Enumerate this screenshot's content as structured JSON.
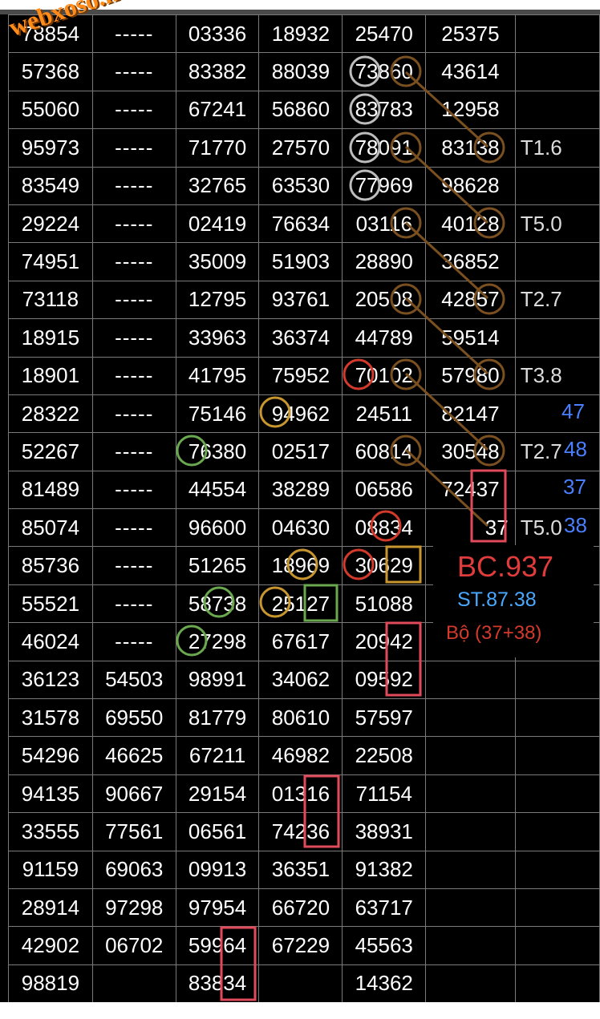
{
  "watermark": "webxoso.net",
  "rows": [
    [
      "78854",
      "-----",
      "03336",
      "18932",
      "25470",
      "25375",
      ""
    ],
    [
      "57368",
      "-----",
      "83382",
      "88039",
      "73860",
      "43614",
      ""
    ],
    [
      "55060",
      "-----",
      "67241",
      "56860",
      "83783",
      "12958",
      ""
    ],
    [
      "95973",
      "-----",
      "71770",
      "27570",
      "78091",
      "83138",
      "T1.6"
    ],
    [
      "83549",
      "-----",
      "32765",
      "63530",
      "77969",
      "98628",
      ""
    ],
    [
      "29224",
      "-----",
      "02419",
      "76634",
      "03116",
      "40128",
      "T5.0"
    ],
    [
      "74951",
      "-----",
      "35009",
      "51903",
      "28890",
      "36852",
      ""
    ],
    [
      "73118",
      "-----",
      "12795",
      "93761",
      "20508",
      "42857",
      "T2.7"
    ],
    [
      "18915",
      "-----",
      "33963",
      "36374",
      "44789",
      "59514",
      ""
    ],
    [
      "18901",
      "-----",
      "41795",
      "75952",
      "70102",
      "57980",
      "T3.8"
    ],
    [
      "28322",
      "-----",
      "75146",
      "94962",
      "24511",
      "82147",
      ""
    ],
    [
      "52267",
      "-----",
      "76380",
      "02517",
      "60814",
      "30548",
      "T2.7"
    ],
    [
      "81489",
      "-----",
      "44554",
      "38289",
      "06586",
      "72437",
      ""
    ],
    [
      "85074",
      "-----",
      "96600",
      "04630",
      "08834",
      "37",
      "T5.0"
    ],
    [
      "85736",
      "-----",
      "51265",
      "18969",
      "30629",
      "",
      ""
    ],
    [
      "55521",
      "-----",
      "58738",
      "25127",
      "51088",
      "",
      ""
    ],
    [
      "46024",
      "-----",
      "27298",
      "67617",
      "20942",
      "",
      ""
    ],
    [
      "36123",
      "54503",
      "98991",
      "34062",
      "09592",
      "",
      ""
    ],
    [
      "31578",
      "69550",
      "81779",
      "80610",
      "57597",
      "",
      ""
    ],
    [
      "54296",
      "46625",
      "67211",
      "46982",
      "22508",
      "",
      ""
    ],
    [
      "94135",
      "90667",
      "29154",
      "01316",
      "71154",
      "",
      ""
    ],
    [
      "33555",
      "77561",
      "06561",
      "74236",
      "38931",
      "",
      ""
    ],
    [
      "91159",
      "69063",
      "09913",
      "36351",
      "91382",
      "",
      ""
    ],
    [
      "28914",
      "97298",
      "97954",
      "66720",
      "63717",
      "",
      ""
    ],
    [
      "42902",
      "06702",
      "59964",
      "67229",
      "45563",
      "",
      ""
    ],
    [
      "98819",
      "",
      "83834",
      "",
      "14362",
      "",
      ""
    ]
  ],
  "side_numbers": [
    "47",
    "48",
    "37",
    "38"
  ],
  "summary": {
    "bc": "BC.937",
    "st": "ST.87.38",
    "bo": "Bộ (37+38)"
  },
  "colors": {
    "brown": "#7a5020",
    "grey": "#bdbdbd",
    "red": "#d33a2c",
    "gold": "#c8962e",
    "green": "#6aa84f",
    "pink": "#e04a5a"
  }
}
